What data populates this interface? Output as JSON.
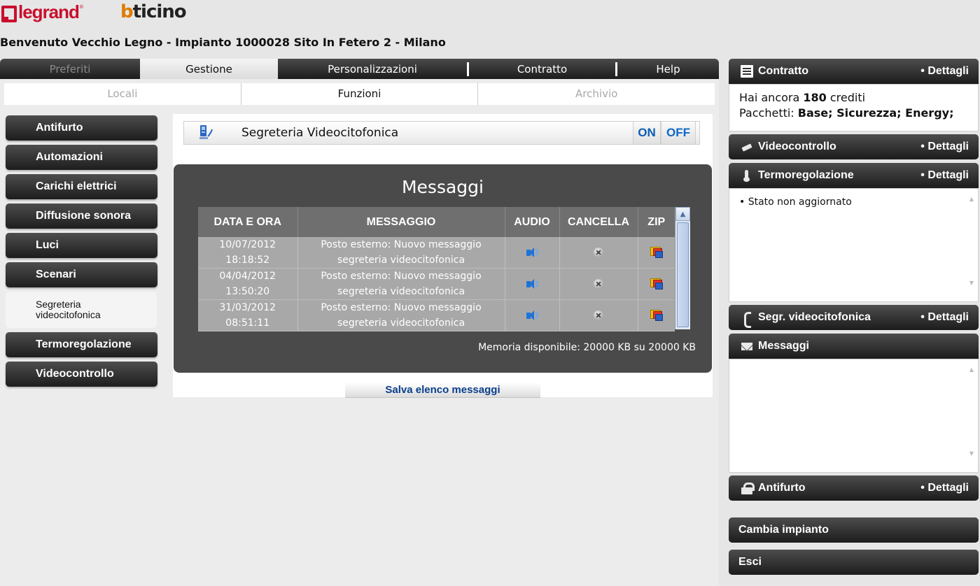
{
  "header": {
    "logo_legrand": "legrand",
    "logo_bticino": "bticino",
    "welcome": "Benvenuto Vecchio Legno - Impianto 1000028 Sito In Fetero 2 - Milano"
  },
  "topnav": {
    "tabs": [
      {
        "label": "Preferiti",
        "state": "faded"
      },
      {
        "label": "Gestione",
        "state": "active"
      },
      {
        "label": "Personalizzazioni",
        "state": "normal"
      },
      {
        "label": "Contratto",
        "state": "normal"
      },
      {
        "label": "Help",
        "state": "normal"
      }
    ]
  },
  "subnav": {
    "tabs": [
      {
        "label": "Locali",
        "state": "faded"
      },
      {
        "label": "Funzioni",
        "state": "active"
      },
      {
        "label": "Archivio",
        "state": "faded"
      }
    ]
  },
  "leftmenu": {
    "items": [
      {
        "label": "Antifurto"
      },
      {
        "label": "Automazioni"
      },
      {
        "label": "Carichi elettrici"
      },
      {
        "label": "Diffusione sonora"
      },
      {
        "label": "Luci"
      },
      {
        "label": "Scenari"
      },
      {
        "label": "Segreteria videocitofonica",
        "active": true
      },
      {
        "label": "Termoregolazione"
      },
      {
        "label": "Videocontrollo"
      }
    ]
  },
  "function": {
    "title": "Segreteria Videocitofonica",
    "icon": "intercom-icon",
    "on_label": "ON",
    "off_label": "OFF"
  },
  "messages": {
    "title": "Messaggi",
    "columns": [
      "DATA E ORA",
      "MESSAGGIO",
      "AUDIO",
      "CANCELLA",
      "ZIP"
    ],
    "rows": [
      {
        "date": "10/07/2012",
        "time": "18:18:52",
        "msg1": "Posto esterno: Nuovo messaggio",
        "msg2": "segreteria videocitofonica"
      },
      {
        "date": "04/04/2012",
        "time": "13:50:20",
        "msg1": "Posto esterno: Nuovo messaggio",
        "msg2": "segreteria videocitofonica"
      },
      {
        "date": "31/03/2012",
        "time": "08:51:11",
        "msg1": "Posto esterno: Nuovo messaggio",
        "msg2": "segreteria videocitofonica"
      }
    ],
    "memory": "Memoria disponibile: 20000 KB su 20000 KB",
    "save_label": "Salva elenco messaggi"
  },
  "right": {
    "contratto": {
      "label": "Contratto",
      "details": "• Dettagli",
      "icon": "document-icon"
    },
    "contratto_box": {
      "line1_prefix": "Hai ancora ",
      "credits": "180",
      "line1_suffix": " crediti",
      "line2_prefix": "Pacchetti: ",
      "packages": "Base; Sicurezza; Energy;"
    },
    "videocontrollo": {
      "label": "Videocontrollo",
      "details": "• Dettagli",
      "icon": "camera-icon"
    },
    "termoregolazione": {
      "label": "Termoregolazione",
      "details": "• Dettagli",
      "icon": "thermometer-icon"
    },
    "termo_box": {
      "status": "• Stato non aggiornato"
    },
    "segr": {
      "label": "Segr. videocitofonica",
      "details": "• Dettagli",
      "icon": "phone-icon"
    },
    "messaggi": {
      "label": "Messaggi",
      "icon": "envelope-icon"
    },
    "antifurto": {
      "label": "Antifurto",
      "details": "• Dettagli",
      "icon": "lock-icon"
    },
    "cambia": {
      "label": "Cambia impianto"
    },
    "esci": {
      "label": "Esci"
    }
  }
}
